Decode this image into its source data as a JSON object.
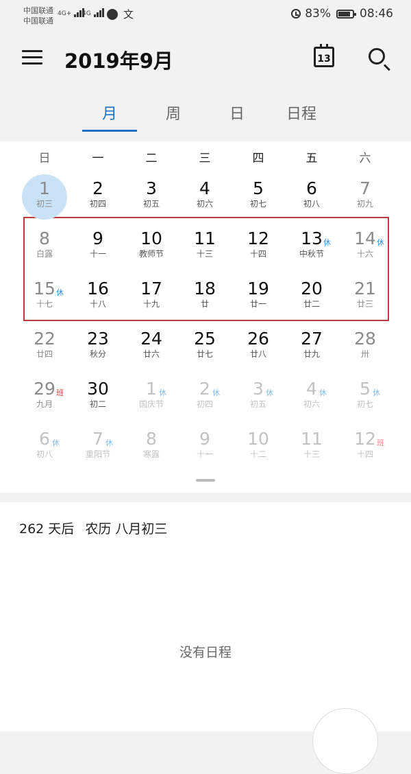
{
  "status_bar": {
    "carrier_1": "中国联通",
    "carrier_2": "中国联通",
    "signal_1": "4G+",
    "signal_2": "4G",
    "wen_glyph": "文",
    "battery_percent": "83%",
    "time": "08:46"
  },
  "header": {
    "title": "2019年9月",
    "today_icon_day": "13"
  },
  "tabs": [
    {
      "label": "月",
      "active": true
    },
    {
      "label": "周",
      "active": false
    },
    {
      "label": "日",
      "active": false
    },
    {
      "label": "日程",
      "active": false
    }
  ],
  "weekdays": [
    "日",
    "一",
    "二",
    "三",
    "四",
    "五",
    "六"
  ],
  "colors": {
    "accent": "#1d73c6",
    "today_circle": "#c9e2f6",
    "rest_badge": "#2f8fd0",
    "work_badge": "#d0433b",
    "selection_border": "#c0393f",
    "weekend_text": "#8a8a8a",
    "other_month_text": "#c2c2c2"
  },
  "days": [
    {
      "day": "1",
      "lunar": "初三",
      "today": true,
      "weekend": true,
      "other": false,
      "badge": ""
    },
    {
      "day": "2",
      "lunar": "初四",
      "weekend": false,
      "other": false,
      "badge": ""
    },
    {
      "day": "3",
      "lunar": "初五",
      "weekend": false,
      "other": false,
      "badge": ""
    },
    {
      "day": "4",
      "lunar": "初六",
      "weekend": false,
      "other": false,
      "badge": ""
    },
    {
      "day": "5",
      "lunar": "初七",
      "weekend": false,
      "other": false,
      "badge": ""
    },
    {
      "day": "6",
      "lunar": "初八",
      "weekend": false,
      "other": false,
      "badge": ""
    },
    {
      "day": "7",
      "lunar": "初九",
      "weekend": true,
      "other": false,
      "badge": ""
    },
    {
      "day": "8",
      "lunar": "白露",
      "weekend": true,
      "other": false,
      "badge": ""
    },
    {
      "day": "9",
      "lunar": "十一",
      "weekend": false,
      "other": false,
      "badge": ""
    },
    {
      "day": "10",
      "lunar": "教师节",
      "weekend": false,
      "other": false,
      "badge": ""
    },
    {
      "day": "11",
      "lunar": "十三",
      "weekend": false,
      "other": false,
      "badge": ""
    },
    {
      "day": "12",
      "lunar": "十四",
      "weekend": false,
      "other": false,
      "badge": ""
    },
    {
      "day": "13",
      "lunar": "中秋节",
      "weekend": false,
      "other": false,
      "badge": "休"
    },
    {
      "day": "14",
      "lunar": "十六",
      "weekend": true,
      "other": false,
      "badge": "休"
    },
    {
      "day": "15",
      "lunar": "十七",
      "weekend": true,
      "other": false,
      "badge": "休"
    },
    {
      "day": "16",
      "lunar": "十八",
      "weekend": false,
      "other": false,
      "badge": ""
    },
    {
      "day": "17",
      "lunar": "十九",
      "weekend": false,
      "other": false,
      "badge": ""
    },
    {
      "day": "18",
      "lunar": "廿",
      "weekend": false,
      "other": false,
      "badge": ""
    },
    {
      "day": "19",
      "lunar": "廿一",
      "weekend": false,
      "other": false,
      "badge": ""
    },
    {
      "day": "20",
      "lunar": "廿二",
      "weekend": false,
      "other": false,
      "badge": ""
    },
    {
      "day": "21",
      "lunar": "廿三",
      "weekend": true,
      "other": false,
      "badge": ""
    },
    {
      "day": "22",
      "lunar": "廿四",
      "weekend": true,
      "other": false,
      "badge": ""
    },
    {
      "day": "23",
      "lunar": "秋分",
      "weekend": false,
      "other": false,
      "badge": ""
    },
    {
      "day": "24",
      "lunar": "廿六",
      "weekend": false,
      "other": false,
      "badge": ""
    },
    {
      "day": "25",
      "lunar": "廿七",
      "weekend": false,
      "other": false,
      "badge": ""
    },
    {
      "day": "26",
      "lunar": "廿八",
      "weekend": false,
      "other": false,
      "badge": ""
    },
    {
      "day": "27",
      "lunar": "廿九",
      "weekend": false,
      "other": false,
      "badge": ""
    },
    {
      "day": "28",
      "lunar": "卅",
      "weekend": true,
      "other": false,
      "badge": ""
    },
    {
      "day": "29",
      "lunar": "九月",
      "weekend": true,
      "other": false,
      "badge": "班"
    },
    {
      "day": "30",
      "lunar": "初二",
      "weekend": false,
      "other": false,
      "badge": ""
    },
    {
      "day": "1",
      "lunar": "国庆节",
      "weekend": false,
      "other": true,
      "badge": "休"
    },
    {
      "day": "2",
      "lunar": "初四",
      "weekend": false,
      "other": true,
      "badge": "休"
    },
    {
      "day": "3",
      "lunar": "初五",
      "weekend": false,
      "other": true,
      "badge": "休"
    },
    {
      "day": "4",
      "lunar": "初六",
      "weekend": false,
      "other": true,
      "badge": "休"
    },
    {
      "day": "5",
      "lunar": "初七",
      "weekend": true,
      "other": true,
      "badge": "休"
    },
    {
      "day": "6",
      "lunar": "初八",
      "weekend": true,
      "other": true,
      "badge": "休"
    },
    {
      "day": "7",
      "lunar": "重阳节",
      "weekend": false,
      "other": true,
      "badge": "休"
    },
    {
      "day": "8",
      "lunar": "寒露",
      "weekend": false,
      "other": true,
      "badge": ""
    },
    {
      "day": "9",
      "lunar": "十一",
      "weekend": false,
      "other": true,
      "badge": ""
    },
    {
      "day": "10",
      "lunar": "十二",
      "weekend": false,
      "other": true,
      "badge": ""
    },
    {
      "day": "11",
      "lunar": "十三",
      "weekend": false,
      "other": true,
      "badge": ""
    },
    {
      "day": "12",
      "lunar": "十四",
      "weekend": true,
      "other": true,
      "badge": "班"
    }
  ],
  "info": {
    "days_after": "262 天后",
    "lunar_label": "农历 八月初三"
  },
  "empty_text": "没有日程"
}
